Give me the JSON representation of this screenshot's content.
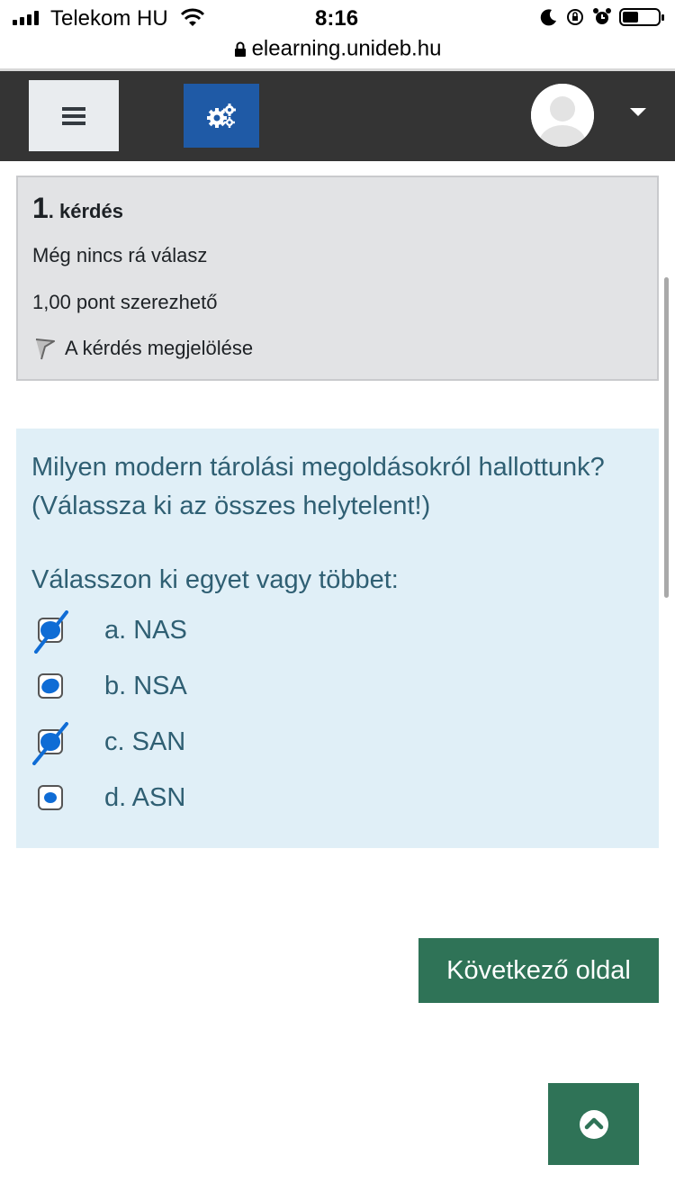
{
  "status_bar": {
    "carrier": "Telekom HU",
    "time": "8:16",
    "battery_level": 0.45
  },
  "browser": {
    "url": "elearning.unideb.hu"
  },
  "navbar": {
    "menu_icon": "hamburger-icon",
    "settings_icon": "gears-icon",
    "user_icon": "avatar-icon",
    "dropdown_icon": "caret-down-icon",
    "settings_color": "#1f5aa6",
    "navbar_color": "#343434"
  },
  "question_info": {
    "number": "1",
    "number_suffix": ". kérdés",
    "status": "Még nincs rá válasz",
    "grade": "1,00 pont szerezhető",
    "flag_label": "A kérdés megjelölése"
  },
  "question": {
    "text": "Milyen modern tárolási megoldásokról hallottunk? (Válassza ki az összes helytelent!)",
    "prompt": "Válasszon ki egyet vagy többet:",
    "answers": [
      {
        "label": "a. NAS",
        "marked": true,
        "strikethrough": true
      },
      {
        "label": "b. NSA",
        "marked": true,
        "strikethrough": false
      },
      {
        "label": "c. SAN",
        "marked": true,
        "strikethrough": true
      },
      {
        "label": "d. ASN",
        "marked": true,
        "strikethrough": false
      }
    ]
  },
  "buttons": {
    "next_page": "Következő oldal",
    "back_to_top_icon": "chevron-up-circle-icon",
    "accent_color": "#2f7357"
  }
}
